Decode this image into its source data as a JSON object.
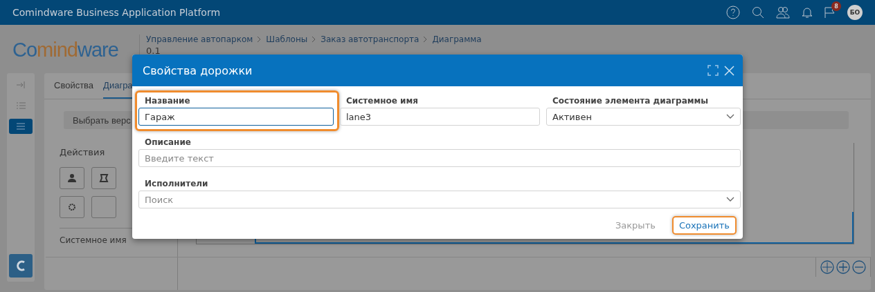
{
  "app_bar": {
    "title": "Comindware Business Application Platform",
    "notifications_count": "8",
    "avatar": "БО"
  },
  "logo": {
    "parts": [
      "Co",
      "mind",
      "ware"
    ]
  },
  "breadcrumbs": [
    "Управление автопарком",
    "Шаблоны",
    "Заказ автотранспорта",
    "Диаграмма"
  ],
  "version": "0.1",
  "rail": [
    {
      "selected": false
    },
    {
      "selected": false
    },
    {
      "selected": true
    }
  ],
  "tabs": [
    {
      "label": "Свойства",
      "selected": false
    },
    {
      "label": "Диагра",
      "selected": true
    }
  ],
  "version_button": "Выбрать верс",
  "palette": {
    "title": "Действия",
    "footer": "Системное имя"
  },
  "dialog": {
    "title": "Свойства дорожки",
    "fields": [
      {
        "label": "Название",
        "value": "Гараж",
        "kind": "text",
        "highlighted": true
      },
      {
        "label": "Системное имя",
        "value": "lane3",
        "kind": "text",
        "highlighted": false
      },
      {
        "label": "Состояние элемента диаграммы",
        "value": "Активен",
        "kind": "select",
        "highlighted": false
      },
      {
        "label": "Описание",
        "placeholder": "Введите текст",
        "kind": "text",
        "highlighted": false
      },
      {
        "label": "Исполнители",
        "placeholder": "Поиск",
        "kind": "select",
        "highlighted": false
      }
    ],
    "buttons": [
      {
        "label": "Закрыть",
        "kind": "secondary",
        "highlighted": false
      },
      {
        "label": "Сохранить",
        "kind": "primary",
        "highlighted": true
      }
    ]
  }
}
